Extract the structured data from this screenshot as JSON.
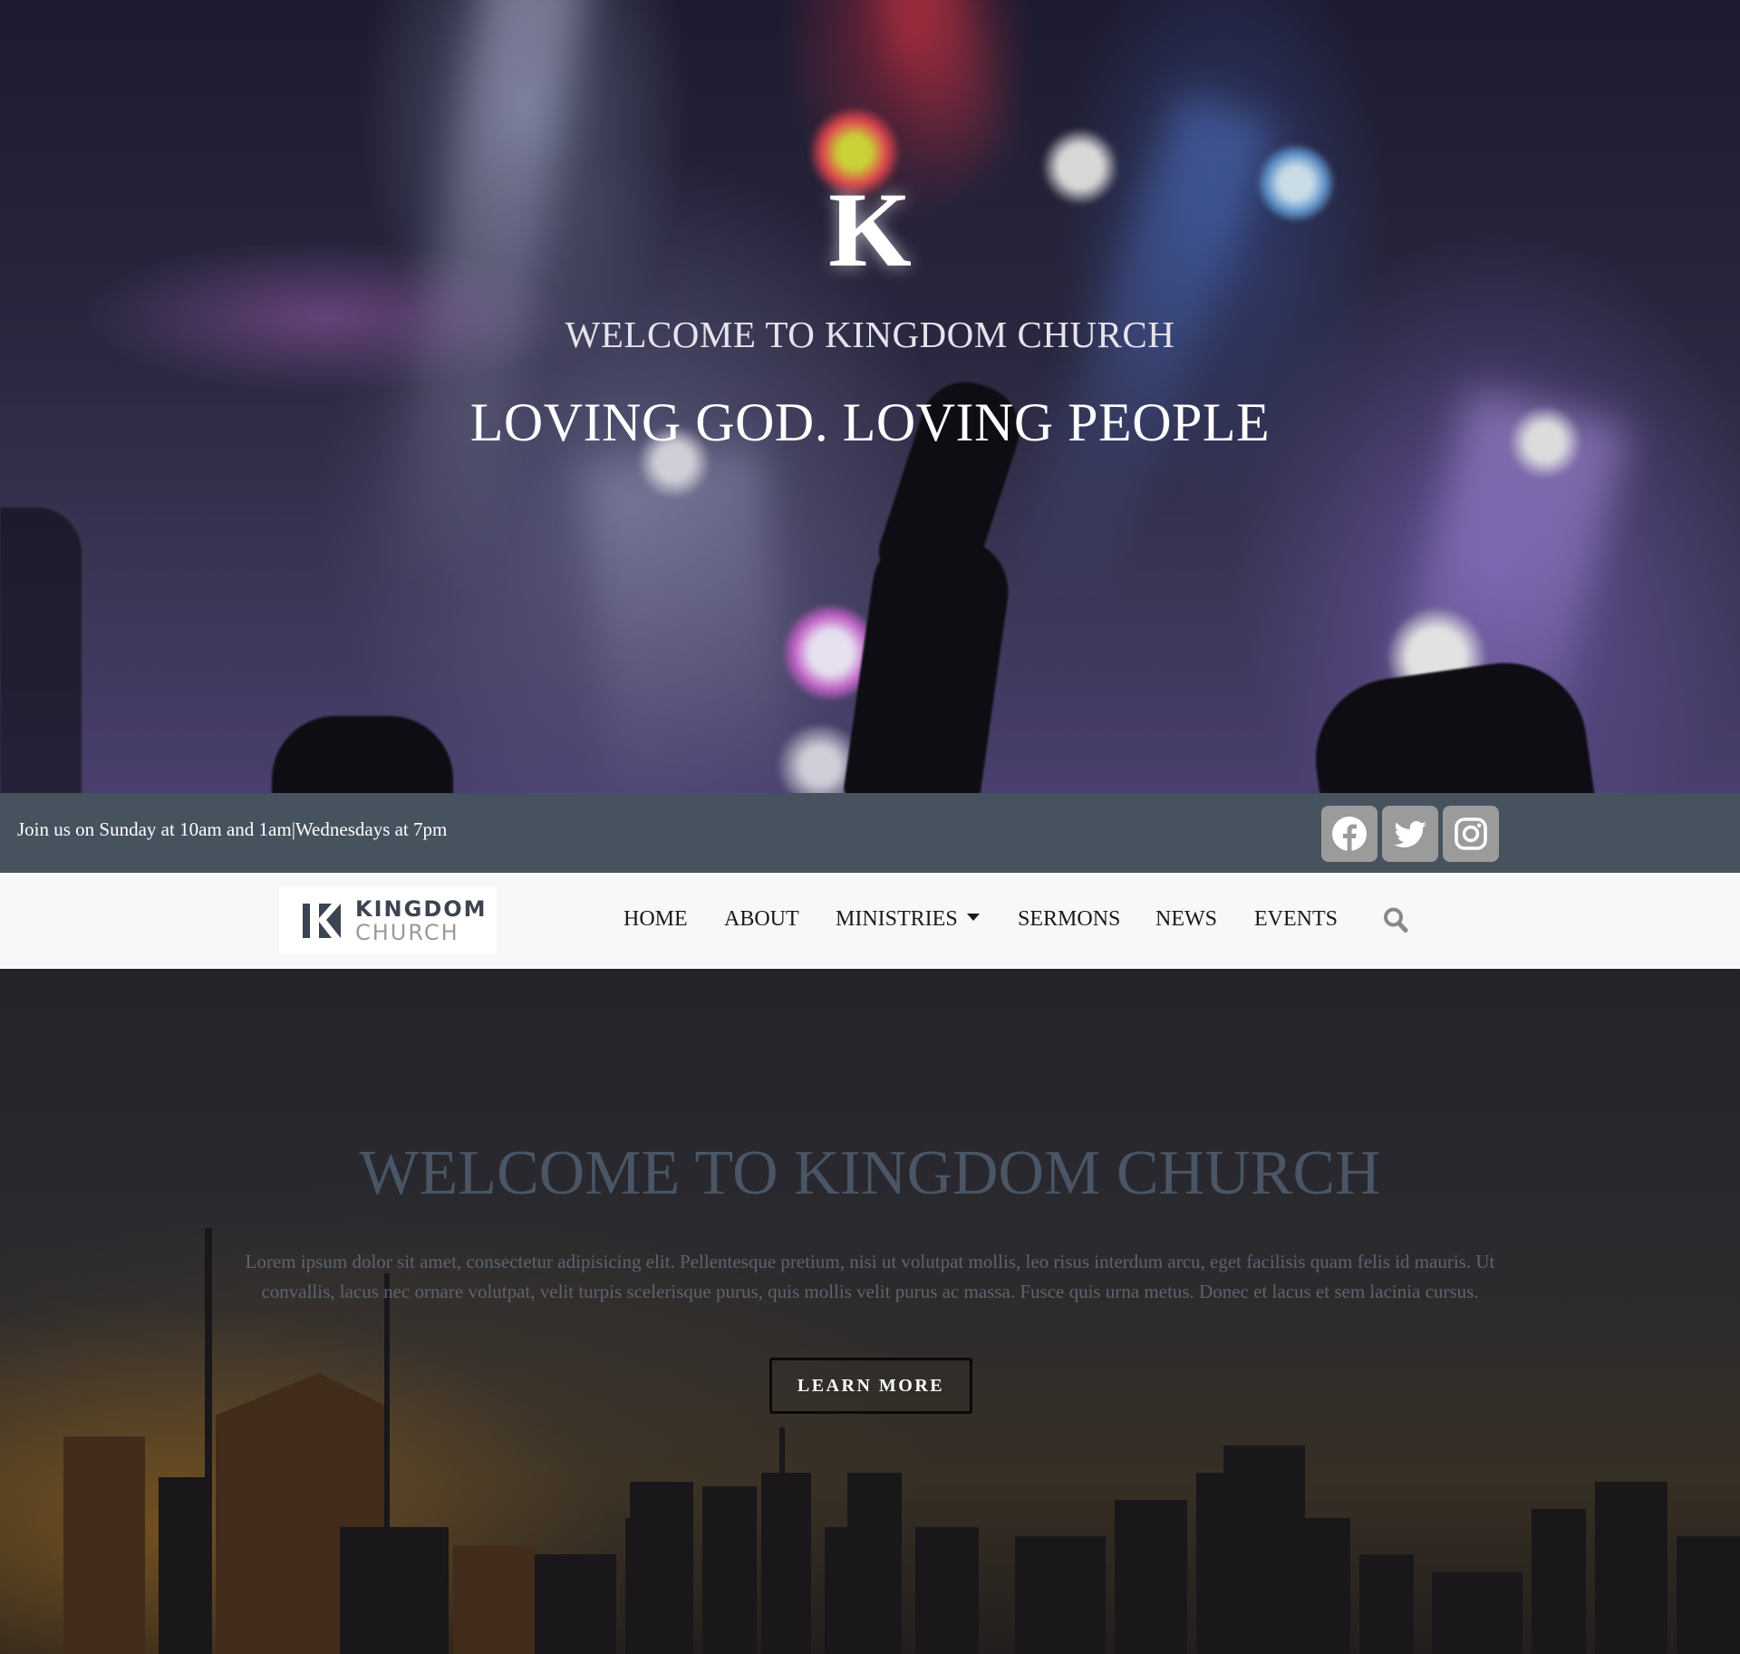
{
  "hero": {
    "logo_letter": "K",
    "welcome": "WELCOME TO KINGDOM CHURCH",
    "tagline": "LOVING GOD. LOVING PEOPLE"
  },
  "topbar": {
    "service_times": "Join us on Sunday at 10am and 1am|Wednesdays at 7pm",
    "social_icons": [
      "facebook-icon",
      "twitter-icon",
      "instagram-icon"
    ],
    "background_color": "#47525f",
    "icon_tile_color": "#9b9b9b"
  },
  "nav": {
    "brand": {
      "line1": "KINGDOM",
      "line2": "CHURCH"
    },
    "items": [
      {
        "label": "HOME"
      },
      {
        "label": "ABOUT"
      },
      {
        "label": "MINISTRIES"
      },
      {
        "label": "SERMONS"
      },
      {
        "label": "NEWS"
      },
      {
        "label": "EVENTS"
      }
    ],
    "search_icon": "search-icon"
  },
  "welcome_section": {
    "title": "WELCOME TO KINGDOM CHURCH",
    "body": "Lorem ipsum dolor sit amet, consectetur adipisicing elit. Pellentesque pretium, nisi ut volutpat mollis, leo risus interdum arcu, eget facilisis quam felis id mauris. Ut convallis, lacus nec ornare volutpat, velit turpis scelerisque purus, quis mollis velit purus ac massa. Fusce quis urna metus. Donec et lacus et sem lacinia cursus.",
    "button_label": "LEARN MORE"
  }
}
